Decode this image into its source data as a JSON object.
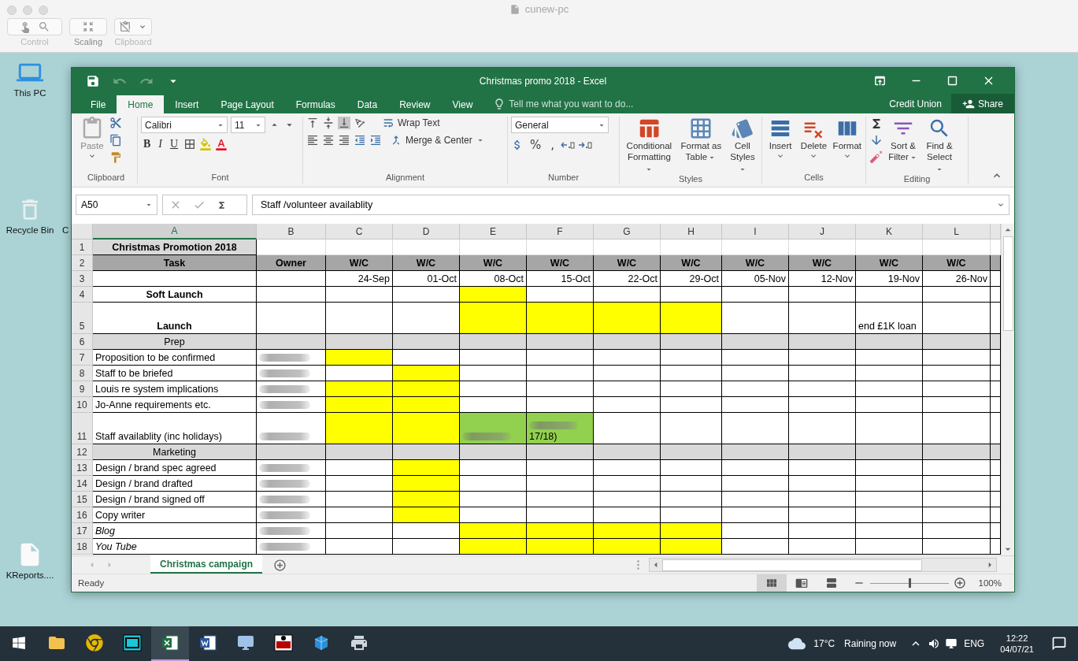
{
  "mac_window": {
    "title": "cunew-pc",
    "toolbar": [
      {
        "label": "Control",
        "kind": "control",
        "disabled": true
      },
      {
        "label": "Scaling",
        "kind": "scaling",
        "disabled": false
      },
      {
        "label": "Clipboard",
        "kind": "clipboard",
        "disabled": true
      }
    ]
  },
  "desktop": {
    "icons": [
      {
        "label": "This PC",
        "kind": "computer"
      },
      {
        "label": "Recycle Bin",
        "kind": "bin"
      },
      {
        "label": "KReports....",
        "kind": "file"
      }
    ],
    "cut_label": "C"
  },
  "excel": {
    "title": "Christmas promo 2018 - Excel",
    "tabs": [
      {
        "label": "File",
        "selected": false
      },
      {
        "label": "Home",
        "selected": true
      },
      {
        "label": "Insert",
        "selected": false
      },
      {
        "label": "Page Layout",
        "selected": false
      },
      {
        "label": "Formulas",
        "selected": false
      },
      {
        "label": "Data",
        "selected": false
      },
      {
        "label": "Review",
        "selected": false
      },
      {
        "label": "View",
        "selected": false
      }
    ],
    "tell_me": "Tell me what you want to do...",
    "account": "Credit Union",
    "share": "Share",
    "ribbon": {
      "groups": [
        "Clipboard",
        "Font",
        "Alignment",
        "Number",
        "Styles",
        "Cells",
        "Editing"
      ],
      "paste": "Paste",
      "font": "Calibri",
      "size": "11",
      "bold": "B",
      "italic": "I",
      "underline": "U",
      "wrap": "Wrap Text",
      "merge": "Merge & Center",
      "number_format": "General",
      "percent": "%",
      "comma": ",",
      "styles": [
        "Conditional Formatting",
        "Format as Table",
        "Cell Styles"
      ],
      "cells": [
        "Insert",
        "Delete",
        "Format"
      ],
      "editing": [
        "Sort & Filter",
        "Find & Select"
      ]
    },
    "name_box": "A50",
    "formula": "Staff /volunteer availablity",
    "columns": [
      {
        "label": "A",
        "selected": true
      },
      {
        "label": "B",
        "selected": false
      },
      {
        "label": "C",
        "selected": false
      },
      {
        "label": "D",
        "selected": false
      },
      {
        "label": "E",
        "selected": false
      },
      {
        "label": "F",
        "selected": false
      },
      {
        "label": "G",
        "selected": false
      },
      {
        "label": "H",
        "selected": false
      },
      {
        "label": "I",
        "selected": false
      },
      {
        "label": "J",
        "selected": false
      },
      {
        "label": "K",
        "selected": false
      },
      {
        "label": "L",
        "selected": false
      }
    ],
    "rows": [
      {
        "number": "1",
        "kind": "title",
        "tall": false,
        "cells": [
          {
            "text": "Christmas Promotion 2018",
            "color": "#d9d9d9"
          },
          {},
          {},
          {},
          {},
          {},
          {},
          {},
          {},
          {},
          {},
          {}
        ]
      },
      {
        "number": "2",
        "kind": "header",
        "tall": false,
        "cells": [
          {
            "text": "Task"
          },
          {
            "text": "Owner"
          },
          {
            "text": "W/C"
          },
          {
            "text": "W/C"
          },
          {
            "text": "W/C"
          },
          {
            "text": "W/C"
          },
          {
            "text": "W/C"
          },
          {
            "text": "W/C"
          },
          {
            "text": "W/C"
          },
          {
            "text": "W/C"
          },
          {
            "text": "W/C"
          },
          {
            "text": "W/C"
          }
        ]
      },
      {
        "number": "3",
        "kind": "date",
        "tall": false,
        "cells": [
          {},
          {},
          {
            "text": "24-Sep"
          },
          {
            "text": "01-Oct"
          },
          {
            "text": "08-Oct"
          },
          {
            "text": "15-Oct"
          },
          {
            "text": "22-Oct"
          },
          {
            "text": "29-Oct"
          },
          {
            "text": "05-Nov"
          },
          {
            "text": "12-Nov"
          },
          {
            "text": "19-Nov"
          },
          {
            "text": "26-Nov"
          }
        ]
      },
      {
        "number": "4",
        "kind": "milestone",
        "tall": false,
        "cells": [
          {
            "text": "Soft Launch"
          },
          {},
          {},
          {},
          {
            "color": "#ffff00"
          },
          {},
          {},
          {},
          {},
          {},
          {},
          {}
        ]
      },
      {
        "number": "5",
        "kind": "milestone",
        "tall": true,
        "cells": [
          {
            "text": "Launch"
          },
          {},
          {},
          {},
          {
            "color": "#ffff00"
          },
          {
            "color": "#ffff00"
          },
          {
            "color": "#ffff00"
          },
          {
            "color": "#ffff00"
          },
          {},
          {},
          {
            "text": "end £1K loan"
          },
          {}
        ]
      },
      {
        "number": "6",
        "kind": "section",
        "tall": false,
        "cells": [
          {
            "text": "Prep"
          },
          {},
          {},
          {},
          {},
          {},
          {},
          {},
          {},
          {},
          {},
          {}
        ]
      },
      {
        "number": "7",
        "kind": "task",
        "tall": false,
        "cells": [
          {
            "text": "Proposition to be confirmed"
          },
          {
            "redacted": true
          },
          {
            "color": "#ffff00"
          },
          {},
          {},
          {},
          {},
          {},
          {},
          {},
          {},
          {}
        ]
      },
      {
        "number": "8",
        "kind": "task",
        "tall": false,
        "cells": [
          {
            "text": "Staff to be briefed"
          },
          {
            "redacted": true
          },
          {},
          {
            "color": "#ffff00"
          },
          {},
          {},
          {},
          {},
          {},
          {},
          {},
          {}
        ]
      },
      {
        "number": "9",
        "kind": "task",
        "tall": false,
        "cells": [
          {
            "text": "Louis re system  implications"
          },
          {
            "redacted": true
          },
          {
            "color": "#ffff00"
          },
          {
            "color": "#ffff00"
          },
          {},
          {},
          {},
          {},
          {},
          {},
          {},
          {}
        ]
      },
      {
        "number": "10",
        "kind": "task",
        "tall": false,
        "cells": [
          {
            "text": "Jo-Anne requirements etc."
          },
          {
            "redacted": true
          },
          {
            "color": "#ffff00"
          },
          {
            "color": "#ffff00"
          },
          {},
          {},
          {},
          {},
          {},
          {},
          {},
          {}
        ]
      },
      {
        "number": "11",
        "kind": "task",
        "tall": true,
        "cells": [
          {
            "text": "Staff availablity (inc holidays)"
          },
          {
            "redacted": true
          },
          {
            "color": "#ffff00"
          },
          {
            "color": "#ffff00"
          },
          {
            "color": "#92d050",
            "redacted": true
          },
          {
            "color": "#92d050",
            "redacted": true,
            "text": "17/18)"
          },
          {},
          {},
          {},
          {},
          {},
          {}
        ]
      },
      {
        "number": "12",
        "kind": "section",
        "tall": false,
        "cells": [
          {
            "text": "Marketing"
          },
          {},
          {},
          {},
          {},
          {},
          {},
          {},
          {},
          {},
          {},
          {}
        ]
      },
      {
        "number": "13",
        "kind": "task",
        "tall": false,
        "cells": [
          {
            "text": "Design / brand spec agreed"
          },
          {
            "redacted": true
          },
          {},
          {
            "color": "#ffff00"
          },
          {},
          {},
          {},
          {},
          {},
          {},
          {},
          {}
        ]
      },
      {
        "number": "14",
        "kind": "task",
        "tall": false,
        "cells": [
          {
            "text": "Design / brand drafted"
          },
          {
            "redacted": true
          },
          {},
          {
            "color": "#ffff00"
          },
          {},
          {},
          {},
          {},
          {},
          {},
          {},
          {}
        ]
      },
      {
        "number": "15",
        "kind": "task",
        "tall": false,
        "cells": [
          {
            "text": "Design / brand signed off"
          },
          {
            "redacted": true
          },
          {},
          {
            "color": "#ffff00"
          },
          {},
          {},
          {},
          {},
          {},
          {},
          {},
          {}
        ]
      },
      {
        "number": "16",
        "kind": "task",
        "tall": false,
        "cells": [
          {
            "text": "Copy writer"
          },
          {
            "redacted": true
          },
          {},
          {
            "color": "#ffff00"
          },
          {},
          {},
          {},
          {},
          {},
          {},
          {},
          {}
        ]
      },
      {
        "number": "17",
        "kind": "channel",
        "tall": false,
        "cells": [
          {
            "text": "Blog"
          },
          {
            "redacted": true
          },
          {},
          {},
          {
            "color": "#ffff00"
          },
          {
            "color": "#ffff00"
          },
          {
            "color": "#ffff00"
          },
          {
            "color": "#ffff00"
          },
          {},
          {},
          {},
          {}
        ]
      },
      {
        "number": "18",
        "kind": "channel",
        "tall": false,
        "cells": [
          {
            "text": "You Tube"
          },
          {
            "redacted": true
          },
          {},
          {},
          {
            "color": "#ffff00"
          },
          {
            "color": "#ffff00"
          },
          {
            "color": "#ffff00"
          },
          {
            "color": "#ffff00"
          },
          {},
          {},
          {},
          {}
        ]
      }
    ],
    "sheets": [
      {
        "label": "Christmas campaign",
        "selected": true
      }
    ],
    "status": "Ready",
    "zoom": {
      "level": 0.5,
      "reading": "100%"
    }
  },
  "taskbar": {
    "apps": [
      {
        "kind": "explorer",
        "selected": false
      },
      {
        "kind": "chrome",
        "selected": false
      },
      {
        "kind": "sql",
        "selected": false
      },
      {
        "kind": "excel",
        "selected": true
      },
      {
        "kind": "word",
        "selected": false
      },
      {
        "kind": "remote",
        "selected": false
      },
      {
        "kind": "vnc",
        "selected": false
      },
      {
        "kind": "blue",
        "selected": false
      },
      {
        "kind": "printer",
        "selected": false
      }
    ],
    "temperature": "17°C",
    "weather": "Raining now",
    "language": "ENG",
    "time": "12:22",
    "date": "04/07/21"
  }
}
